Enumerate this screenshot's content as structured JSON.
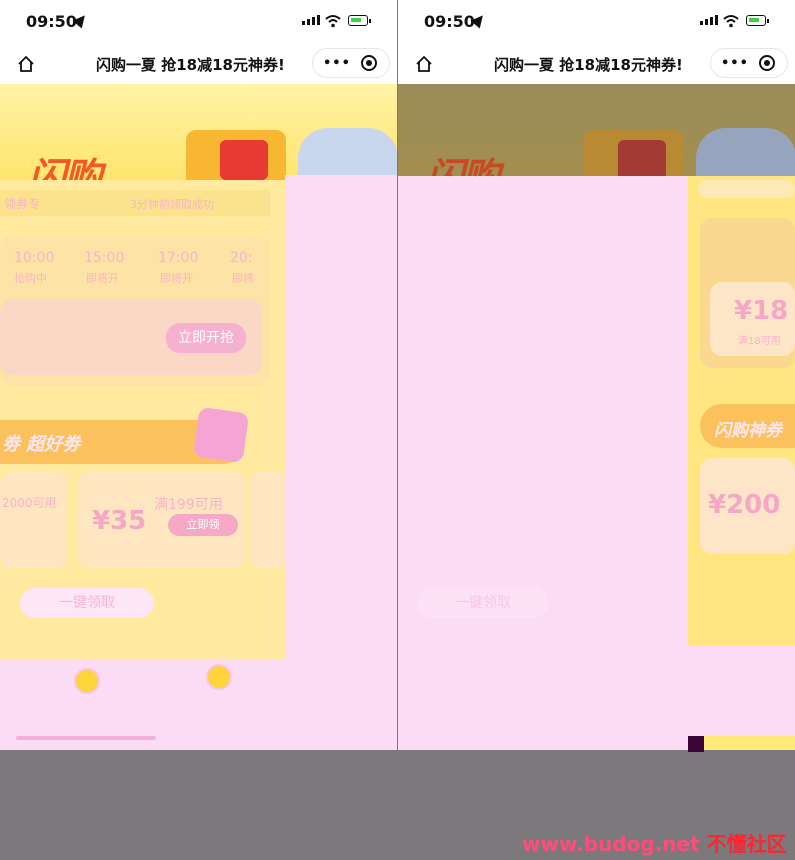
{
  "status_bar": {
    "time": "09:50"
  },
  "nav_bar": {
    "title": "闪购一夏 抢18减18元神券!",
    "menu_label": "•••"
  },
  "banner": {
    "logo_text": "闪购"
  },
  "left_screen": {
    "badge_text": "领券专",
    "ticker_text": "3分钟前领取成功",
    "time_tabs": [
      "10:00",
      "15:00",
      "17:00",
      "20:"
    ],
    "time_tab_subs": [
      "抢购中",
      "即将开",
      "即将开",
      "即将"
    ],
    "deal_button": "立即开抢",
    "section_title": "劵 超好劵",
    "coupon_amount": "¥35",
    "coupon_condition": "满199可用",
    "coupon_button": "立即领",
    "coupon_left_condition": "2000可用",
    "one_click_button": "一键领取"
  },
  "right_screen": {
    "coupon_amount_1": "¥18",
    "coupon_sub_1": "满18可用",
    "section_title": "闪购神券",
    "coupon_amount_2": "¥200",
    "one_click_button": "一键领取"
  },
  "watermark": {
    "url": "www.budog.net",
    "name": "不懂社区"
  }
}
